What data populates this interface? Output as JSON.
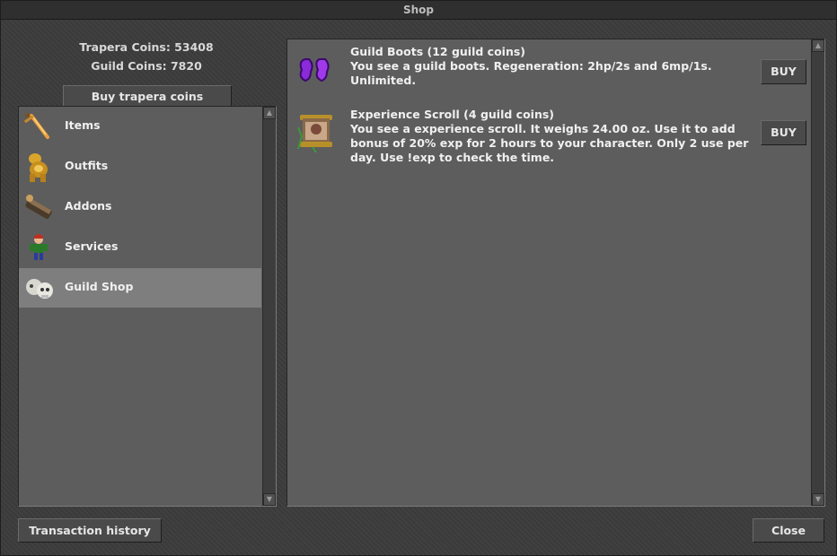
{
  "window": {
    "title": "Shop"
  },
  "balance": {
    "trapera_coins": "Trapera Coins: 53408",
    "guild_coins": "Guild Coins: 7820"
  },
  "buy_coins_label": "Buy trapera coins",
  "categories": [
    {
      "label": "Items",
      "icon": "sword-icon"
    },
    {
      "label": "Outfits",
      "icon": "golden-armor-icon"
    },
    {
      "label": "Addons",
      "icon": "cannon-addon-icon"
    },
    {
      "label": "Services",
      "icon": "character-icon"
    },
    {
      "label": "Guild Shop",
      "icon": "skulls-icon",
      "selected": true
    }
  ],
  "offers": [
    {
      "name": "Guild Boots (12 guild coins)",
      "description": "You see a guild boots. Regeneration: 2hp/2s and 6mp/1s. Unlimited.",
      "buy_label": "BUY",
      "icon": "purple-boots-icon"
    },
    {
      "name": "Experience Scroll (4 guild coins)",
      "description": "You see a experience scroll. It weighs 24.00 oz. Use it to add bonus of 20% exp for 2 hours to your character. Only 2 use per day. Use !exp to check the time.",
      "buy_label": "BUY",
      "icon": "scroll-icon"
    }
  ],
  "footer": {
    "transaction_history_label": "Transaction history",
    "close_label": "Close"
  },
  "colors": {
    "panel": "#5d5d5d",
    "selected_row": "#7e7e7e",
    "window_bg": "#3c3c3c"
  }
}
